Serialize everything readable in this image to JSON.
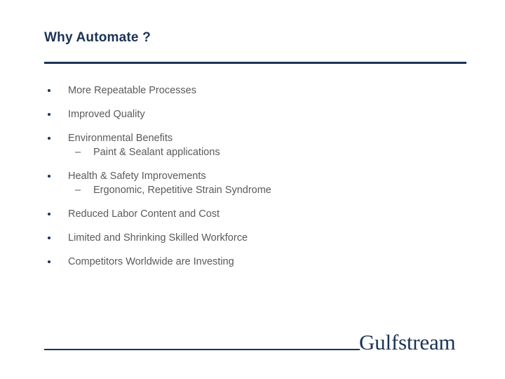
{
  "slide": {
    "title": "Why Automate ?",
    "background_color": "#ffffff",
    "accent_color": "#1b3356",
    "body_text_color": "#5a5a5a"
  },
  "body": {
    "bullets": [
      {
        "level": 1,
        "marker": "bullet-dot",
        "text": "More Repeatable Processes"
      },
      {
        "level": 1,
        "marker": "bullet-dot",
        "text": "Improved Quality"
      },
      {
        "level": 1,
        "marker": "bullet-dot",
        "text": "Environmental Benefits"
      },
      {
        "level": 2,
        "marker": "–",
        "text": "Paint & Sealant applications"
      },
      {
        "level": 1,
        "marker": "bullet-dot",
        "text": "Health & Safety Improvements"
      },
      {
        "level": 2,
        "marker": "–",
        "text": "Ergonomic, Repetitive Strain Syndrome"
      },
      {
        "level": 1,
        "marker": "bullet-dot",
        "text": "Reduced Labor Content and Cost"
      },
      {
        "level": 1,
        "marker": "bullet-dot",
        "text": "Limited and Shrinking Skilled Workforce"
      },
      {
        "level": 1,
        "marker": "bullet-dot",
        "text": "Competitors Worldwide are Investing"
      }
    ]
  },
  "footer": {
    "brand": "Gulfstream"
  }
}
